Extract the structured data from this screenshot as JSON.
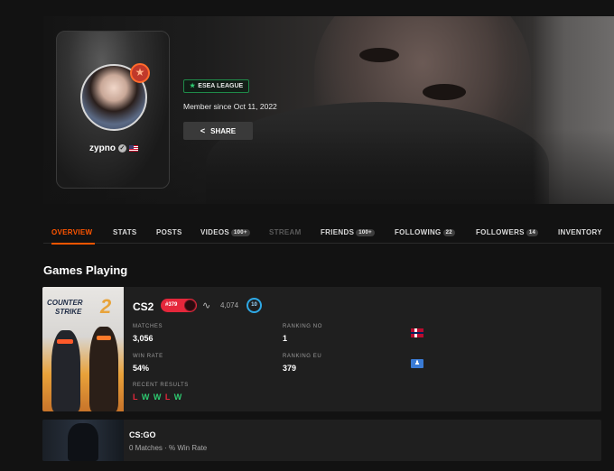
{
  "profile": {
    "username": "zypno",
    "esea_badge": "ESEA LEAGUE",
    "member_since": "Member since Oct 11, 2022",
    "share_label": "SHARE"
  },
  "tabs": [
    {
      "label": "OVERVIEW",
      "count": ""
    },
    {
      "label": "STATS",
      "count": ""
    },
    {
      "label": "POSTS",
      "count": ""
    },
    {
      "label": "VIDEOS",
      "count": "100+"
    },
    {
      "label": "STREAM",
      "count": ""
    },
    {
      "label": "FRIENDS",
      "count": "100+"
    },
    {
      "label": "FOLLOWING",
      "count": "22"
    },
    {
      "label": "FOLLOWERS",
      "count": "14"
    },
    {
      "label": "INVENTORY",
      "count": ""
    }
  ],
  "section_title": "Games Playing",
  "cs2": {
    "art_logo_1": "COUNTER",
    "art_logo_2": "STRIKE",
    "art_logo_3": "2",
    "name": "CS2",
    "rating": "#379",
    "elo": "4,074",
    "level": "10",
    "matches_label": "MATCHES",
    "matches_value": "3,056",
    "win_rate_label": "WIN RATE",
    "win_rate_value": "54%",
    "ranking_no_label": "RANKING NO",
    "ranking_no_value": "1",
    "ranking_eu_label": "RANKING EU",
    "ranking_eu_value": "379",
    "recent_results_label": "RECENT RESULTS",
    "recent_results": [
      "L",
      "W",
      "W",
      "L",
      "W"
    ]
  },
  "csgo": {
    "name": "CS:GO",
    "subtitle": "0 Matches · % Win Rate"
  },
  "colors": {
    "accent": "#ff5500",
    "win": "#2ecc71",
    "loss": "#e5273b",
    "esea_green": "#1f8a49",
    "level_blue": "#2ea8e5"
  }
}
